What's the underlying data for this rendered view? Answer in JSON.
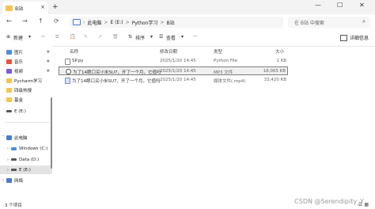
{
  "window": {
    "tab_title": "B站",
    "tab_close": "×",
    "new_tab": "+",
    "minimize": "—",
    "maximize": "☐",
    "close": "✕"
  },
  "nav": {
    "back": "←",
    "forward": "→",
    "up": "↑",
    "refresh": "⟳",
    "breadcrumbs": [
      "此电脑",
      "E (E:)",
      "Python学习",
      "B站"
    ],
    "separator": ">",
    "more": "›",
    "search_placeholder": "在 B站 中搜索",
    "search_icon": "⌕"
  },
  "commands": {
    "new_label": "新建",
    "new_icon": "⊕",
    "cut": "✂",
    "copy": "⧉",
    "paste": "📋",
    "rename": "✎",
    "share": "↗",
    "delete": "🗑",
    "sort_label": "排序",
    "view_label": "查看",
    "more": "···",
    "details_label": "详细信息"
  },
  "sidebar": {
    "items": [
      {
        "label": "图片",
        "icon": "pictures-icon",
        "color": "#4a90d9",
        "pinned": true
      },
      {
        "label": "音乐",
        "icon": "music-icon",
        "color": "#e2553d",
        "pinned": true
      },
      {
        "label": "视频",
        "icon": "videos-icon",
        "color": "#7a5ad8",
        "pinned": true
      },
      {
        "label": "Pycharm学习",
        "icon": "folder-icon",
        "color": "#f5c451",
        "pinned": false
      },
      {
        "label": "四级热搜",
        "icon": "folder-icon",
        "color": "#f5c451",
        "pinned": false
      },
      {
        "label": "基金",
        "icon": "folder-icon",
        "color": "#f5c451",
        "pinned": false
      },
      {
        "label": "E (E:)",
        "icon": "drive-icon",
        "color": "#555555",
        "pinned": false
      },
      {
        "label": "此电脑",
        "icon": "pc-icon",
        "color": "#4a7bd0",
        "pinned": false
      },
      {
        "label": "Windows (C:)",
        "icon": "drive-icon",
        "color": "#4a90d9",
        "pinned": false
      },
      {
        "label": "Data (D:)",
        "icon": "drive-icon",
        "color": "#555555",
        "pinned": false
      },
      {
        "label": "E (E:)",
        "icon": "drive-icon",
        "color": "#555555",
        "pinned": false
      },
      {
        "label": "网络",
        "icon": "network-icon",
        "color": "#4a7bd0",
        "pinned": false
      }
    ],
    "pin_icon": "✱"
  },
  "filelist": {
    "columns": {
      "name": "名称",
      "date": "修改日期",
      "type": "类型",
      "size": "大小"
    },
    "rows": [
      {
        "name": "SP.py",
        "date": "2025/1/20 14:45",
        "type": "Python File",
        "size": "1 KB",
        "icon": "python-file-icon"
      },
      {
        "name": "为了14眼口买小米SU7，开了一个月，它值吗",
        "date": "2025/1/20 14:45",
        "type": "MP3 文件",
        "size": "18,065 KB",
        "icon": "mp3-file-icon"
      },
      {
        "name": "为了14眼口买小米SU7，开了一个月，它值吗",
        "date": "2025/1/20 14:45",
        "type": "媒体文件(.mp4)",
        "size": "33,420 KB",
        "icon": "mp4-file-icon"
      }
    ]
  },
  "status": {
    "count": "3 个项目",
    "view_list": "☰",
    "view_tiles": "▦"
  },
  "watermark": "CSDN @Serendipity_Y"
}
